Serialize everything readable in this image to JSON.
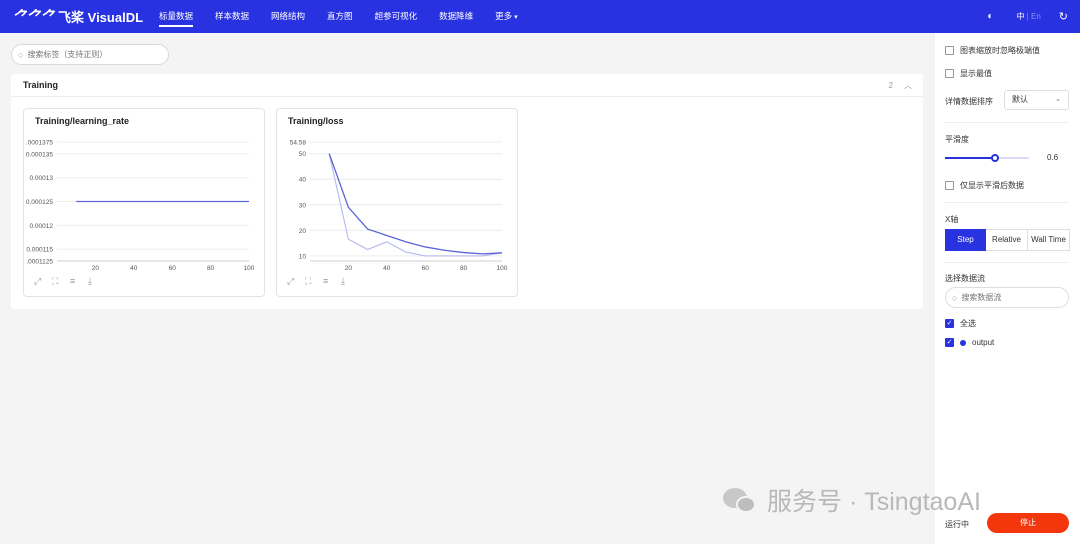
{
  "app": {
    "logo_mark": "飞桨",
    "logo_text": "飞桨 VisualDL"
  },
  "nav": {
    "items": [
      {
        "label": "标量数据",
        "active": true
      },
      {
        "label": "样本数据"
      },
      {
        "label": "网络结构"
      },
      {
        "label": "直方图"
      },
      {
        "label": "超参可视化"
      },
      {
        "label": "数据降维"
      },
      {
        "label": "更多"
      }
    ],
    "more_caret": "▾",
    "lang_active": "中",
    "lang_sep": " | ",
    "lang_other": "En"
  },
  "search": {
    "placeholder": "搜索标签（支持正则）"
  },
  "panel": {
    "title": "Training",
    "count": "2",
    "collapse_icon": "︿"
  },
  "charts": [
    {
      "title": "Training/learning_rate",
      "y_tick_labels": [
        ".0001375",
        "0.000135",
        "0.00013",
        "0.000125",
        "0.00012",
        "0.000115",
        ".0001125"
      ]
    },
    {
      "title": "Training/loss",
      "y_tick_labels": [
        "54.58",
        "50",
        "40",
        "30",
        "20",
        "10"
      ]
    }
  ],
  "chart_data": [
    {
      "type": "line",
      "title": "Training/learning_rate",
      "x": [
        10,
        20,
        30,
        40,
        50,
        60,
        70,
        80,
        90,
        100
      ],
      "x_ticks": [
        0,
        20,
        40,
        60,
        80,
        100
      ],
      "xlim": [
        0,
        100
      ],
      "ylim": [
        0.0001125,
        0.0001375
      ],
      "y_ticks": [
        0.0001125,
        0.000115,
        0.00012,
        0.000125,
        0.00013,
        0.000135,
        0.0001375
      ],
      "series": [
        {
          "values": [
            0.000125,
            0.000125,
            0.000125,
            0.000125,
            0.000125,
            0.000125,
            0.000125,
            0.000125,
            0.000125,
            0.000125
          ]
        }
      ]
    },
    {
      "type": "line",
      "title": "Training/loss",
      "x": [
        10,
        20,
        30,
        40,
        50,
        60,
        70,
        80,
        90,
        100
      ],
      "x_ticks": [
        0,
        20,
        40,
        60,
        80,
        100
      ],
      "xlim": [
        0,
        100
      ],
      "ylim": [
        8,
        54.58
      ],
      "y_ticks": [
        10,
        20,
        30,
        40,
        50,
        54.58
      ],
      "series": [
        {
          "values": [
            50,
            29,
            20.5,
            18,
            15.5,
            13.5,
            12.2,
            11.3,
            10.8,
            11.2
          ]
        },
        {
          "values": [
            50,
            16.5,
            12.5,
            15.5,
            11.5,
            10,
            10,
            10,
            10,
            11.2
          ]
        }
      ]
    }
  ],
  "tools": {
    "icons": [
      "fullscreen-icon",
      "restore-icon",
      "filter-icon",
      "download-icon"
    ]
  },
  "sidebar": {
    "ignore_outliers": "图表缩放时忽略极端值",
    "show_extrema": "显示最值",
    "sort_label": "详情数据排序",
    "sort_value": "默认",
    "smoothing_label": "平滑度",
    "smoothing_value": "0.6",
    "smoothing": 0.6,
    "smoothed_only": "仅显示平滑后数据",
    "xaxis_label": "X轴",
    "xaxis_options": [
      "Step",
      "Relative",
      "Wall Time"
    ],
    "runs_label": "选择数据流",
    "runs_search_placeholder": "搜索数据流",
    "select_all": "全选",
    "run_name": "output",
    "status": "运行中",
    "stop": "停止"
  },
  "colors": {
    "brand": "#2932e1",
    "stop": "#f4360c",
    "line_main": "#5b63d6",
    "line_raw": "#b4b8ef"
  },
  "watermark": {
    "text": "服务号 · TsingtaoAI"
  }
}
